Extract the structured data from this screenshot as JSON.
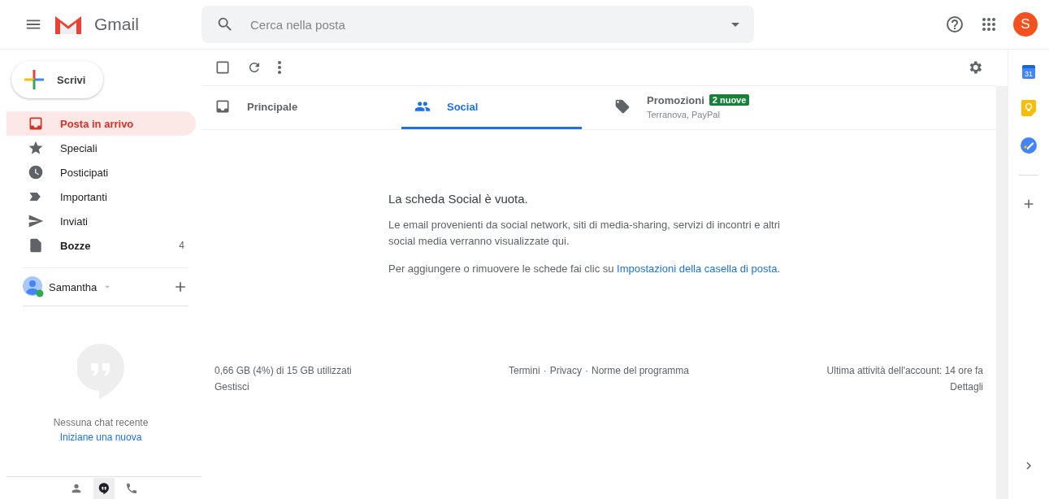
{
  "header": {
    "app_name": "Gmail",
    "search": {
      "placeholder": "Cerca nella posta"
    },
    "avatar_letter": "S"
  },
  "compose": {
    "label": "Scrivi"
  },
  "sidebar": {
    "items": [
      {
        "label": "Posta in arrivo",
        "selected": true,
        "bold": true
      },
      {
        "label": "Speciali",
        "selected": false,
        "bold": false
      },
      {
        "label": "Posticipati",
        "selected": false,
        "bold": false
      },
      {
        "label": "Importanti",
        "selected": false,
        "bold": false
      },
      {
        "label": "Inviati",
        "selected": false,
        "bold": false
      },
      {
        "label": "Bozze",
        "selected": false,
        "bold": true,
        "count": "4"
      }
    ]
  },
  "chat": {
    "user": "Samantha",
    "online": true,
    "empty_text": "Nessuna chat recente",
    "start_link": "Iniziane una nuova",
    "footer_tabs": [
      {
        "selected": false
      },
      {
        "selected": true
      },
      {
        "selected": false
      }
    ]
  },
  "tabs": [
    {
      "label": "Principale",
      "selected": false
    },
    {
      "label": "Social",
      "selected": true
    },
    {
      "label": "Promozioni",
      "selected": false,
      "badge": "2 nuove",
      "subtitle": "Terranova, PayPal"
    }
  ],
  "empty": {
    "title": "La scheda Social è vuota.",
    "body": "Le email provenienti da social network, siti di media-sharing, servizi di incontri e altri social media verranno visualizzate qui.",
    "hint_before": "Per aggiungere o rimuovere le schede fai clic su ",
    "hint_link": "Impostazioni della casella di posta",
    "hint_after": "."
  },
  "footer": {
    "storage": "0,66 GB (4%) di 15 GB utilizzati",
    "manage": "Gestisci",
    "links": [
      "Termini",
      "Privacy",
      "Norme del programma"
    ],
    "separator": "·",
    "activity": "Ultima attività dell'account: 14 ore fa",
    "details": "Dettagli"
  },
  "side_panel": {
    "calendar_day": "31"
  }
}
